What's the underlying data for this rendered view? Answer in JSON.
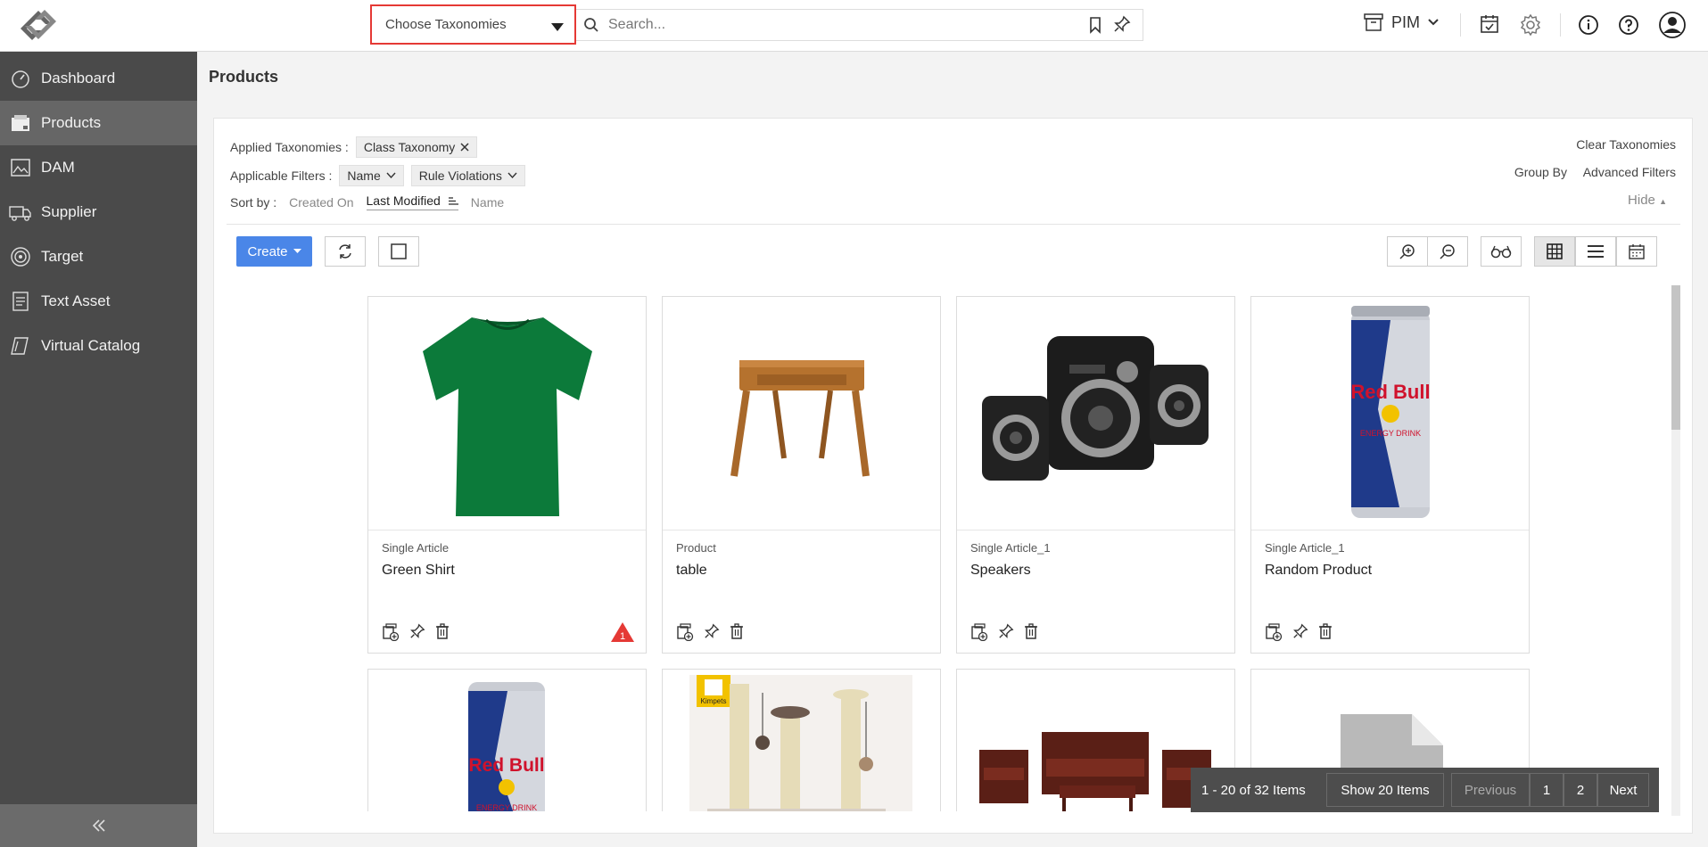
{
  "topbar": {
    "taxonomy_select": "Choose Taxonomies",
    "search_placeholder": "Search...",
    "module_label": "PIM"
  },
  "sidebar": {
    "items": [
      {
        "label": "Dashboard",
        "icon": "speedometer-icon"
      },
      {
        "label": "Products",
        "icon": "box-icon",
        "active": true
      },
      {
        "label": "DAM",
        "icon": "image-icon"
      },
      {
        "label": "Supplier",
        "icon": "truck-icon"
      },
      {
        "label": "Target",
        "icon": "target-icon"
      },
      {
        "label": "Text Asset",
        "icon": "document-icon"
      },
      {
        "label": "Virtual Catalog",
        "icon": "catalog-icon"
      }
    ]
  },
  "page": {
    "title": "Products"
  },
  "filters": {
    "applied_taxonomies_label": "Applied Taxonomies :",
    "applied_taxonomy_chip": "Class Taxonomy",
    "applicable_filters_label": "Applicable Filters :",
    "filter_chips": [
      "Name",
      "Rule Violations"
    ],
    "sort_label": "Sort by :",
    "sort_options": [
      "Created On",
      "Last Modified",
      "Name"
    ],
    "clear_taxonomies": "Clear Taxonomies",
    "group_by": "Group By",
    "advanced_filters": "Advanced Filters",
    "hide": "Hide"
  },
  "toolbar": {
    "create_label": "Create"
  },
  "products": [
    {
      "type": "Single Article",
      "name": "Green Shirt",
      "warning_count": "1"
    },
    {
      "type": "Product",
      "name": "table"
    },
    {
      "type": "Single Article_1",
      "name": "Speakers"
    },
    {
      "type": "Single Article_1",
      "name": "Random Product"
    }
  ],
  "product_images_row2": [
    "red-bull-can",
    "cat-scratching-post",
    "wooden-furniture-set",
    "file-placeholder"
  ],
  "row2_badge": "Kimpets",
  "pagination": {
    "range": "1 - 20 of 32 Items",
    "page_size": "Show 20 Items",
    "previous": "Previous",
    "pages": [
      "1",
      "2"
    ],
    "next": "Next"
  },
  "colors": {
    "accent": "#4a86e8",
    "sidebar_bg": "#4a4a4a",
    "highlight_border": "#e53935",
    "warning": "#e53935"
  }
}
